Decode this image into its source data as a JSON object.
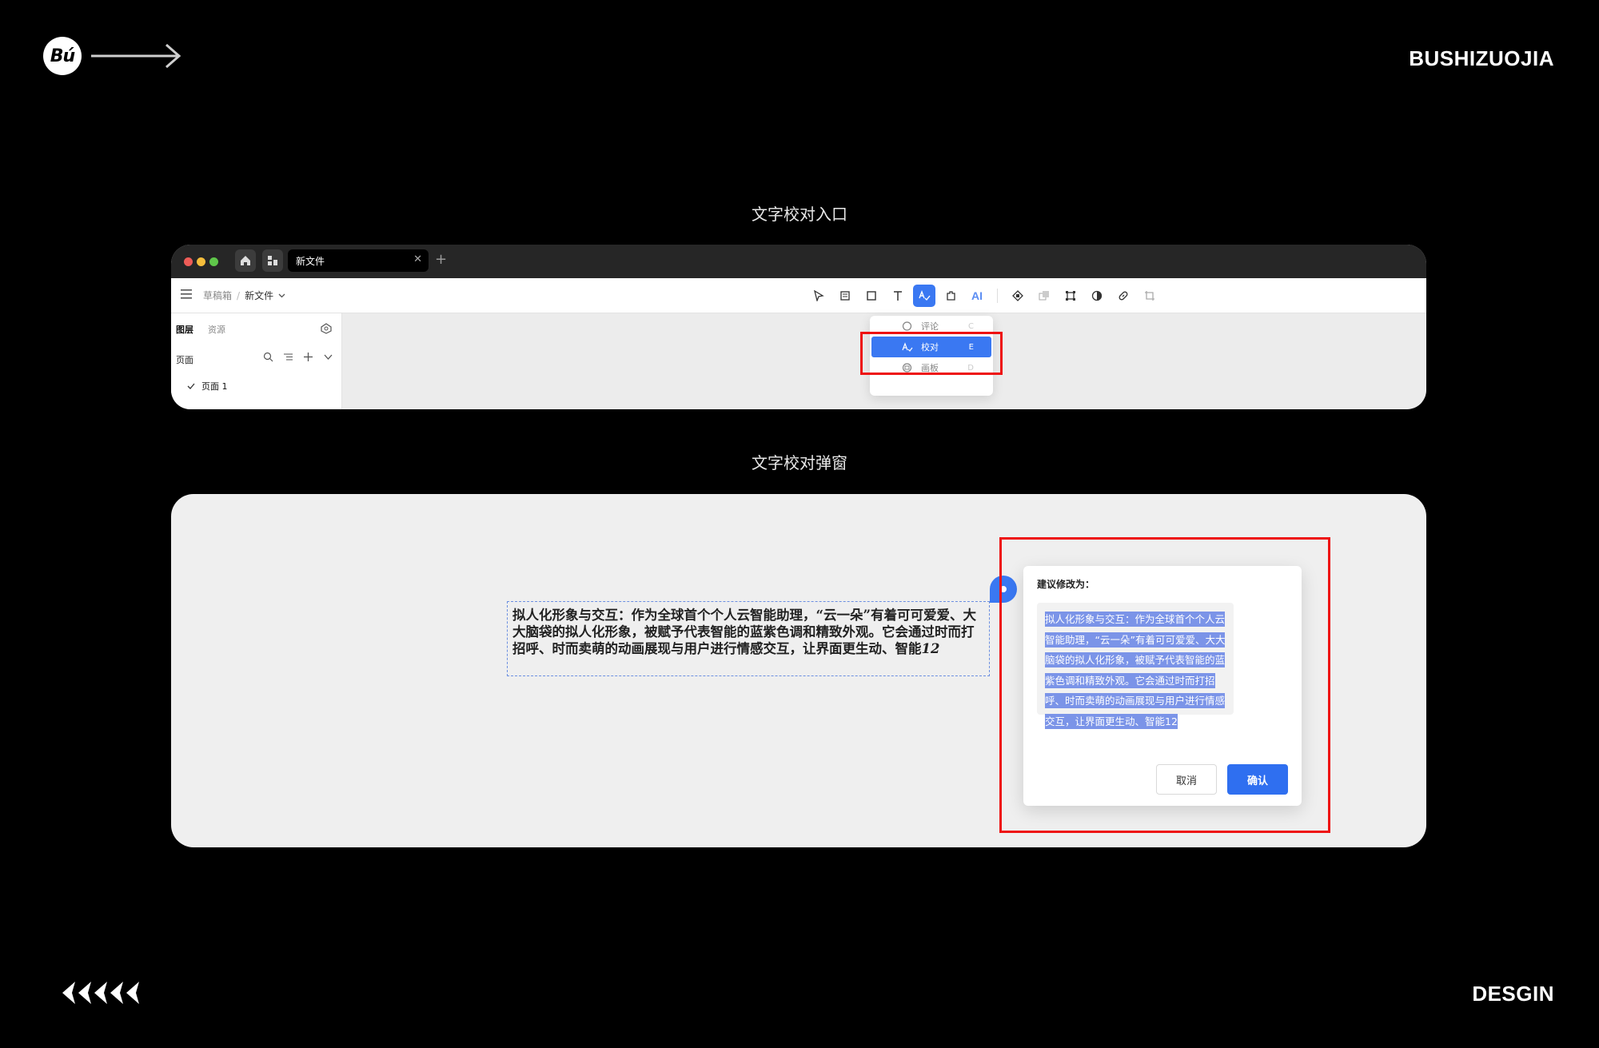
{
  "brand": {
    "logo_text": "Bú",
    "name": "BUSHIZUOJIA",
    "footer_word": "DESGIN"
  },
  "sections": {
    "entry_title": "文字校对入口",
    "dialog_title": "文字校对弹窗"
  },
  "app": {
    "tab_title": "新文件",
    "breadcrumb": {
      "root": "草稿箱",
      "separator": "/",
      "file": "新文件"
    },
    "toolbar_ai_label": "AI",
    "sidebar": {
      "tab_layers": "图层",
      "tab_assets": "资源",
      "pages_label": "页面",
      "page_1": "页面 1"
    },
    "dropdown": [
      {
        "label": "评论",
        "key": "C"
      },
      {
        "label": "校对",
        "key": "E"
      },
      {
        "label": "画板",
        "key": "D"
      }
    ]
  },
  "proofread": {
    "source_text_main": "拟人化形象与交互：作为全球首个个人云智能助理，“云一朵”有着可可爱爱、大大脑袋的拟人化形象，被赋予代表智能的蓝紫色调和精致外观。它会通过时而打招呼、时而卖萌的动画展现与用户进行情感交互，让界面更生动、智能",
    "source_text_tail": "12",
    "dialog_label": "建议修改为：",
    "suggestion": "拟人化形象与交互：作为全球首个个人云智能助理，“云一朵”有着可可爱爱、大大脑袋的拟人化形象，被赋予代表智能的蓝紫色调和精致外观。它会通过时而打招呼、时而卖萌的动画展现与用户进行情感交互，让界面更生动、智能12",
    "cancel": "取消",
    "confirm": "确认"
  },
  "colors": {
    "accent": "#3a78f2",
    "highlight_border": "#e11111",
    "selection": "#7b94e8"
  }
}
